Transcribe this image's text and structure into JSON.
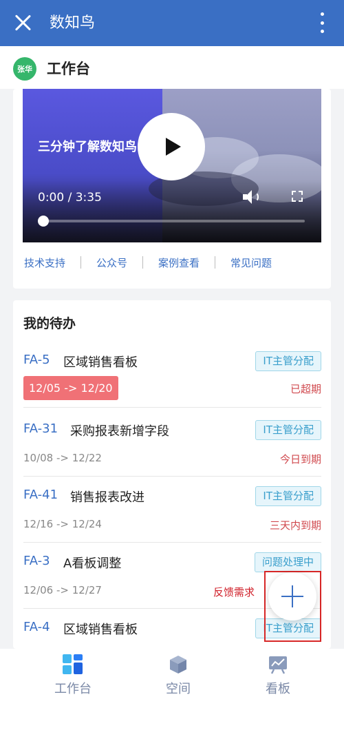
{
  "header": {
    "title": "数知鸟"
  },
  "subheader": {
    "avatar_text": "张华",
    "title": "工作台"
  },
  "video": {
    "caption": "三分钟了解数知鸟",
    "time": "0:00 / 3:35",
    "progress": 0
  },
  "links": [
    "技术支持",
    "公众号",
    "案例查看",
    "常见问题"
  ],
  "todo": {
    "title": "我的待办",
    "tasks": [
      {
        "id": "FA-5",
        "name": "区域销售看板",
        "badge": "IT主管分配",
        "dates": "12/05 -> 12/20",
        "status": "已超期"
      },
      {
        "id": "FA-31",
        "name": "采购报表新增字段",
        "badge": "IT主管分配",
        "dates": "10/08 -> 12/22",
        "status": "今日到期"
      },
      {
        "id": "FA-41",
        "name": "销售报表改进",
        "badge": "IT主管分配",
        "dates": "12/16 -> 12/24",
        "status": "三天内到期"
      },
      {
        "id": "FA-3",
        "name": "A看板调整",
        "badge": "问题处理中",
        "dates": "12/06 -> 12/27",
        "status": ""
      },
      {
        "id": "FA-4",
        "name": "区域销售看板",
        "badge": "IT主管分配",
        "dates": "",
        "status": ""
      }
    ]
  },
  "fab": {
    "label": "反馈需求"
  },
  "tabbar": {
    "items": [
      "工作台",
      "空间",
      "看板"
    ]
  },
  "colors": {
    "primary": "#3a6fc4",
    "danger": "#d0494e",
    "overdue_bg": "#f07176"
  },
  "icons": {
    "workspace": "workspace-icon",
    "space": "cube-icon",
    "board": "board-icon"
  }
}
